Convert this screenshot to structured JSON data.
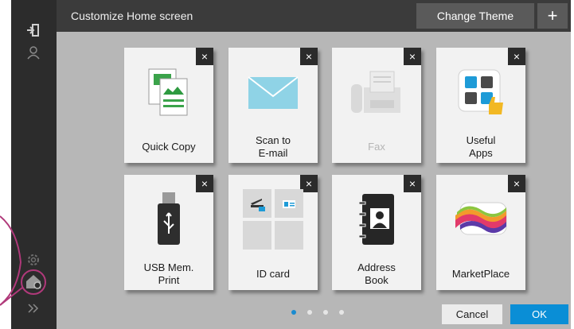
{
  "header": {
    "title": "Customize Home screen",
    "change_theme_label": "Change Theme",
    "add_label": "+"
  },
  "sidebar": {
    "icons": [
      "logout-icon",
      "user-icon",
      "settings-gear-icon",
      "home-settings-icon",
      "expand-chevrons-icon"
    ]
  },
  "tiles": [
    {
      "label": "Quick Copy",
      "icon": "copy-document-icon",
      "enabled": true,
      "close": "×"
    },
    {
      "label": "Scan to\nE-mail",
      "icon": "envelope-icon",
      "enabled": true,
      "close": "×"
    },
    {
      "label": "Fax",
      "icon": "fax-machine-icon",
      "enabled": false,
      "close": "×"
    },
    {
      "label": "Useful\nApps",
      "icon": "apps-thumbs-up-icon",
      "enabled": true,
      "close": "×"
    },
    {
      "label": "USB Mem.\nPrint",
      "icon": "usb-drive-icon",
      "enabled": true,
      "close": "×"
    },
    {
      "label": "ID card",
      "icon": "id-card-icon",
      "enabled": true,
      "close": "×"
    },
    {
      "label": "Address\nBook",
      "icon": "address-book-icon",
      "enabled": true,
      "close": "×"
    },
    {
      "label": "MarketPlace",
      "icon": "marketplace-icon",
      "enabled": true,
      "close": "×"
    }
  ],
  "pagination": {
    "pages": 4,
    "current": 1
  },
  "footer": {
    "cancel_label": "Cancel",
    "ok_label": "OK"
  },
  "colors": {
    "accent": "#0a8ed6",
    "background": "#b7b7b7",
    "callout": "#b0397a"
  }
}
